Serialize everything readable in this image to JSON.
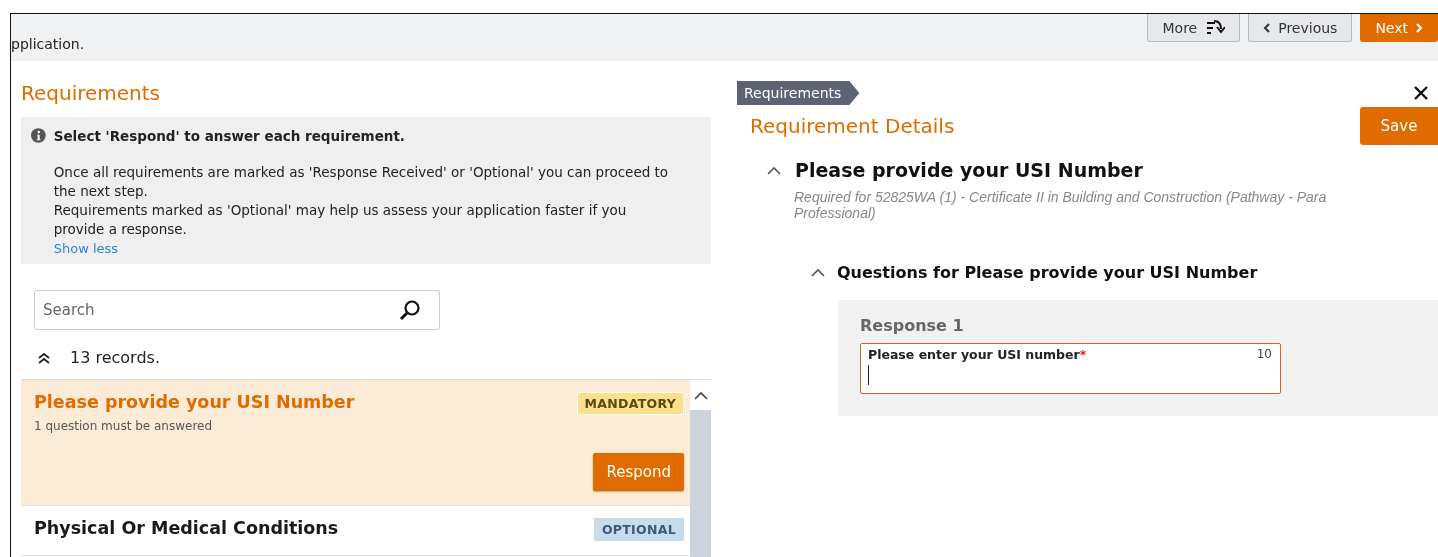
{
  "header": {
    "text": "pplication.",
    "buttons": [
      {
        "label": "More",
        "kind": "more"
      },
      {
        "label": "Previous",
        "kind": "previous"
      },
      {
        "label": "Next",
        "kind": "next"
      }
    ]
  },
  "requirements": {
    "title": "Requirements",
    "info": {
      "heading": "Select 'Respond' to answer each requirement.",
      "lines": [
        "Once all requirements are marked as 'Response Received' or 'Optional' you can proceed to the next step.",
        "Requirements marked as 'Optional' may help us assess your application faster if you provide a response."
      ],
      "link": "Show less"
    },
    "search": {
      "placeholder": "Search"
    },
    "count": "13 records.",
    "items": [
      {
        "title": "Please provide your USI Number",
        "subtitle": "1 question must be answered",
        "badge": "MANDATORY",
        "kind": "mandatory",
        "action": "Respond",
        "selected": true
      },
      {
        "title": "Physical Or Medical Conditions",
        "badge": "OPTIONAL",
        "kind": "optional",
        "selected": false
      }
    ]
  },
  "details": {
    "breadcrumb": "Requirements",
    "title": "Requirement Details",
    "save": "Save",
    "requirement": {
      "title": "Please provide your USI Number",
      "expanded": true,
      "note": "Required for 52825WA (1) - Certificate II in Building and Construction (Pathway - Para Professional)",
      "questions": {
        "title": "Questions for Please provide your USI Number",
        "expanded": true,
        "responses": [
          {
            "heading": "Response 1",
            "label": "Please enter your USI number",
            "required_mark": "*",
            "max_length": "10"
          }
        ]
      }
    }
  }
}
